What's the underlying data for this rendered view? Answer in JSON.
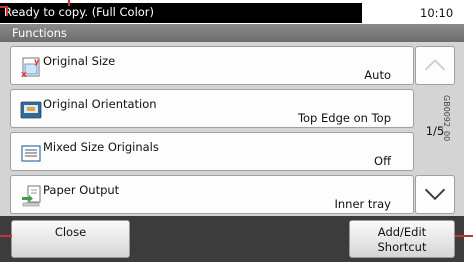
{
  "status": {
    "message": "Ready to copy. (Full Color)",
    "time": "10:10"
  },
  "title": "Functions",
  "functions": [
    {
      "label": "Original Size",
      "value": "Auto",
      "icon": "original-size-icon"
    },
    {
      "label": "Original Orientation",
      "value": "Top Edge on Top",
      "icon": "original-orientation-icon"
    },
    {
      "label": "Mixed Size Originals",
      "value": "Off",
      "icon": "mixed-size-originals-icon"
    },
    {
      "label": "Paper Output",
      "value": "Inner tray",
      "icon": "paper-output-icon"
    }
  ],
  "pager": {
    "text": "1/5"
  },
  "buttons": {
    "close": "Close",
    "add_edit_line1": "Add/Edit",
    "add_edit_line2": "Shortcut"
  },
  "figure_code": "GB0092_00",
  "colors": {
    "callout": "#cc3333",
    "status_bar": "#000000",
    "title_bar": "#7a7a7a",
    "panel": "#d4d4d4",
    "bottom_bar": "#3c3c3c"
  }
}
